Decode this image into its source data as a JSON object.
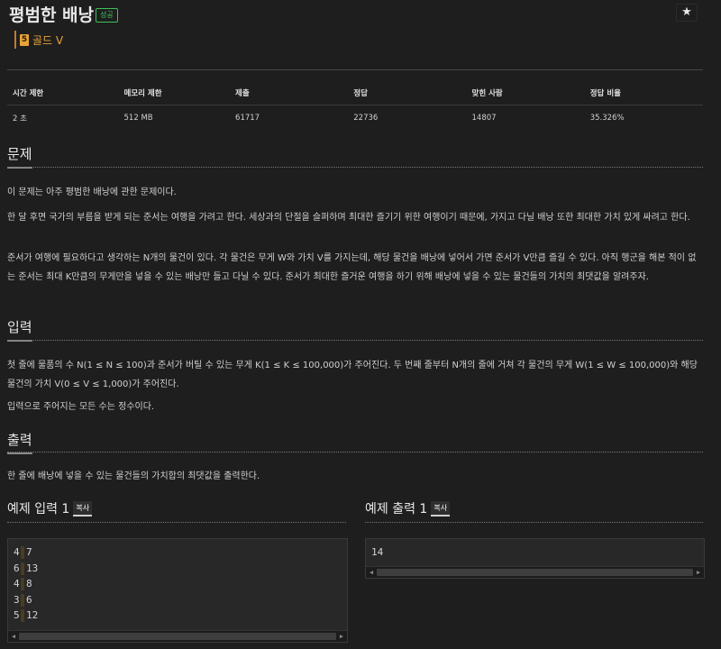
{
  "header": {
    "title": "평범한 배낭",
    "status_badge": "성공",
    "star_icon": "★",
    "tier_number": "5",
    "tier_label": "골드 V"
  },
  "stats": {
    "headers": [
      "시간 제한",
      "메모리 제한",
      "제출",
      "정답",
      "맞힌 사람",
      "정답 비율"
    ],
    "values": [
      "2 초",
      "512 MB",
      "61717",
      "22736",
      "14807",
      "35.326%"
    ]
  },
  "problem": {
    "heading": "문제",
    "paragraphs": [
      "이 문제는 아주 평범한 배낭에 관한 문제이다.",
      "한 달 후면 국가의 부름을 받게 되는 준서는 여행을 가려고 한다. 세상과의 단절을 슬퍼하며 최대한 즐기기 위한 여행이기 때문에, 가지고 다닐 배낭 또한 최대한 가치 있게 싸려고 한다.",
      "준서가 여행에 필요하다고 생각하는 N개의 물건이 있다. 각 물건은 무게 W와 가치 V를 가지는데, 해당 물건을 배낭에 넣어서 가면 준서가 V만큼 즐길 수 있다. 아직 행군을 해본 적이 없는 준서는 최대 K만큼의 무게만을 넣을 수 있는 배낭만 들고 다닐 수 있다. 준서가 최대한 즐거운 여행을 하기 위해 배낭에 넣을 수 있는 물건들의 가치의 최댓값을 알려주자."
    ]
  },
  "input": {
    "heading": "입력",
    "paragraphs": [
      "첫 줄에 물품의 수 N(1 ≤ N ≤ 100)과 준서가 버틸 수 있는 무게 K(1 ≤ K ≤ 100,000)가 주어진다. 두 번째 줄부터 N개의 줄에 거쳐 각 물건의 무게 W(1 ≤ W ≤ 100,000)와 해당 물건의 가치 V(0 ≤ V ≤ 1,000)가 주어진다.",
      "입력으로 주어지는 모든 수는 정수이다."
    ]
  },
  "output": {
    "heading": "출력",
    "paragraphs": [
      "한 줄에 배낭에 넣을 수 있는 물건들의 가치합의 최댓값을 출력한다."
    ]
  },
  "example_input": {
    "title": "예제 입력 1",
    "copy_label": "복사",
    "rows": [
      [
        "4",
        "7"
      ],
      [
        "6",
        "13"
      ],
      [
        "4",
        "8"
      ],
      [
        "3",
        "6"
      ],
      [
        "5",
        "12"
      ]
    ]
  },
  "example_output": {
    "title": "예제 출력 1",
    "copy_label": "복사",
    "text": "14"
  }
}
